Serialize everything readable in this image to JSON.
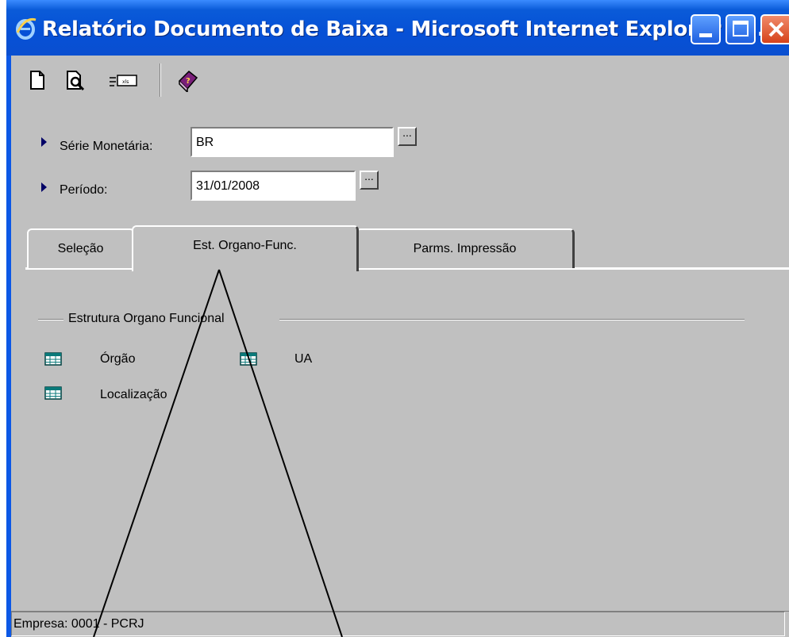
{
  "window": {
    "title": "Relatório Documento de Baixa - Microsoft Internet Explorer pr..."
  },
  "toolbar": {
    "icons": [
      "new-document-icon",
      "print-preview-icon",
      "export-icon",
      "help-book-icon"
    ]
  },
  "form": {
    "serie_label": "Série Monetária:",
    "serie_value": "BR",
    "periodo_label": "Período:",
    "periodo_value": "31/01/2008",
    "lookup_label": "..."
  },
  "tabs": [
    {
      "label": "Seleção"
    },
    {
      "label": "Est. Organo-Func.",
      "active": true
    },
    {
      "label": "Parms. Impressão"
    }
  ],
  "group": {
    "title": "Estrutura Organo Funcional",
    "items": [
      {
        "label": "Órgão"
      },
      {
        "label": "UA"
      },
      {
        "label": "Localização"
      }
    ]
  },
  "statusbar": {
    "text": "Empresa: 0001 - PCRJ"
  },
  "colors": {
    "titlebar": "#0a5bd8",
    "client_bg": "#c0c0c0",
    "close_button": "#d6431b"
  }
}
